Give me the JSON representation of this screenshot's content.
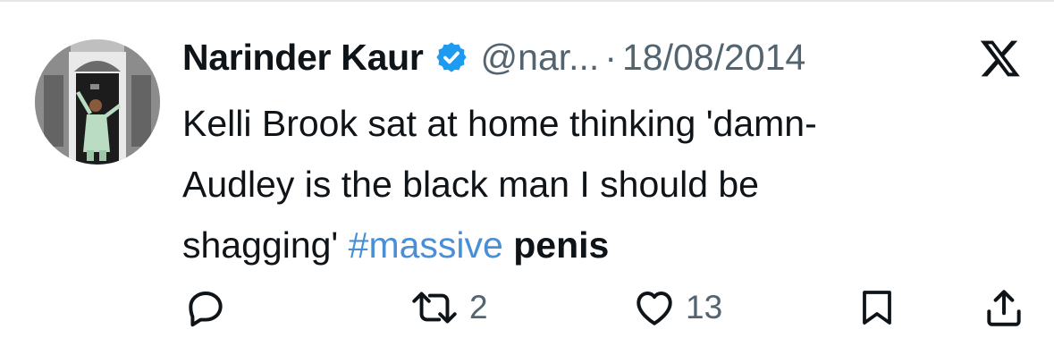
{
  "tweet": {
    "author_name": "Narinder Kaur",
    "handle": "@nar...",
    "separator": "·",
    "date": "18/08/2014",
    "text": {
      "line1": "Kelli Brook sat at home thinking 'damn-",
      "line2": "Audley is the black man I should be",
      "line3_plain": "shagging' ",
      "hashtag": "#massive",
      "bold_word": "penis"
    }
  },
  "actions": {
    "reply": {
      "icon": "reply-icon"
    },
    "retweet": {
      "icon": "retweet-icon",
      "count": "2"
    },
    "like": {
      "icon": "heart-icon",
      "count": "13"
    },
    "bookmark": {
      "icon": "bookmark-icon"
    },
    "share": {
      "icon": "share-icon"
    }
  },
  "colors": {
    "text": "#0f1419",
    "secondary": "#536471",
    "hashtag": "#4a8fd6",
    "verified": "#1d9bf0"
  }
}
